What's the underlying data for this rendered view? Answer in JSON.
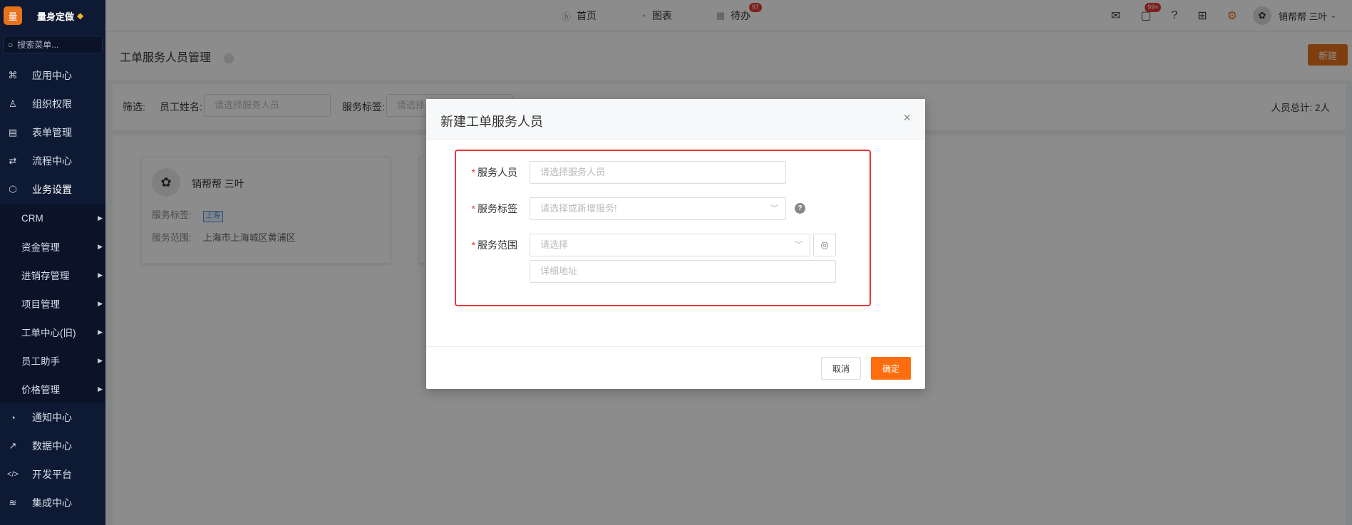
{
  "brand": {
    "logo_text": "量",
    "name": "量身定做",
    "gem": "◆"
  },
  "search": {
    "placeholder": "搜索菜单..."
  },
  "menu": {
    "items_top": [
      {
        "label": "应用中心",
        "icon": "⌘"
      },
      {
        "label": "组织权限",
        "icon": "♙"
      },
      {
        "label": "表单管理",
        "icon": "▤"
      },
      {
        "label": "流程中心",
        "icon": "⇄"
      },
      {
        "label": "业务设置",
        "icon": "⬡"
      }
    ],
    "sub_items": [
      {
        "label": "CRM"
      },
      {
        "label": "资金管理"
      },
      {
        "label": "进销存管理"
      },
      {
        "label": "项目管理"
      },
      {
        "label": "工单中心(旧)"
      },
      {
        "label": "员工助手"
      },
      {
        "label": "价格管理"
      }
    ],
    "items_bottom": [
      {
        "label": "通知中心",
        "icon": "◔"
      },
      {
        "label": "数据中心",
        "icon": "↗"
      },
      {
        "label": "开发平台",
        "icon": "</>"
      },
      {
        "label": "集成中心",
        "icon": "≋"
      }
    ]
  },
  "topnav": {
    "home": "首页",
    "charts": "图表",
    "todo": "待办",
    "todo_badge": "97"
  },
  "topright": {
    "msg_badge": "99+",
    "user_name": "销帮帮 三叶"
  },
  "page": {
    "title": "工单服务人员管理",
    "new_button": "新建"
  },
  "filter": {
    "label": "筛选:",
    "name_label": "员工姓名:",
    "name_placeholder": "请选择服务人员",
    "tag_label": "服务标签:",
    "tag_placeholder": "请选择",
    "total": "人员总计: 2人"
  },
  "cards": [
    {
      "name": "销帮帮 三叶",
      "tag_label": "服务标签:",
      "tag": "上海",
      "scope_label": "服务范围:",
      "scope": "上海市上海城区黄浦区"
    }
  ],
  "modal": {
    "title": "新建工单服务人员",
    "close": "×",
    "fields": {
      "person_label": "服务人员",
      "person_placeholder": "请选择服务人员",
      "tag_label": "服务标签",
      "tag_placeholder": "请选择或新增服务!",
      "scope_label": "服务范围",
      "scope_placeholder": "请选择",
      "address_placeholder": "详细地址"
    },
    "cancel": "取消",
    "ok": "确定"
  }
}
